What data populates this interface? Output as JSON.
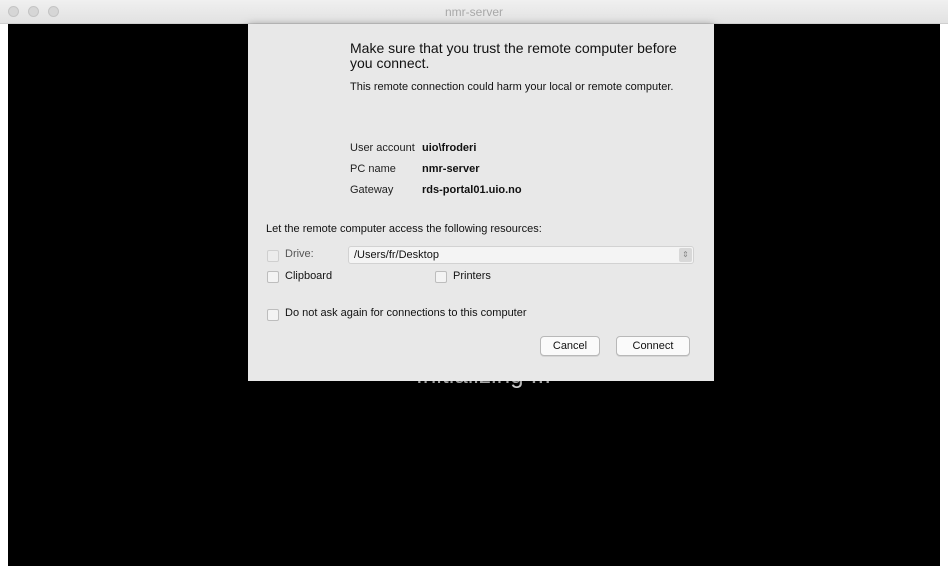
{
  "window": {
    "title": "nmr-server"
  },
  "screen": {
    "status_text": "Initializing ..."
  },
  "dialog": {
    "headline": "Make sure that you trust the remote computer before you connect.",
    "warning": "This remote connection could harm your local or remote computer.",
    "info": [
      {
        "label": "User account",
        "value": "uio\\froderi"
      },
      {
        "label": "PC name",
        "value": "nmr-server"
      },
      {
        "label": "Gateway",
        "value": "rds-portal01.uio.no"
      }
    ],
    "resources_heading": "Let the remote computer access the following resources:",
    "drive": {
      "label": "Drive:",
      "path": "/Users/fr/Desktop",
      "checked": false
    },
    "clipboard": {
      "label": "Clipboard",
      "checked": false
    },
    "printers": {
      "label": "Printers",
      "checked": false
    },
    "dont_ask": {
      "label": "Do not ask again for connections to this computer",
      "checked": false
    },
    "buttons": {
      "cancel": "Cancel",
      "connect": "Connect"
    }
  }
}
